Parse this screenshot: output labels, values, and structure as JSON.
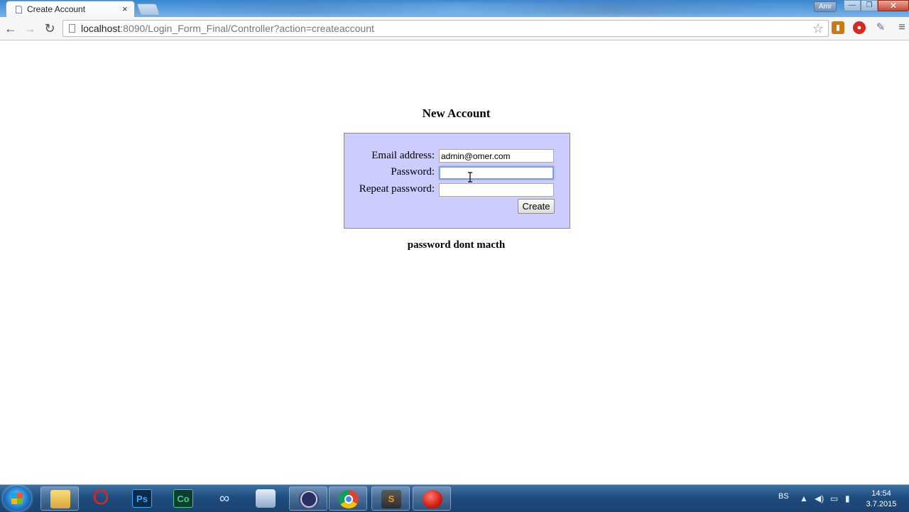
{
  "browser": {
    "tab": {
      "title": "Create Account",
      "close_glyph": "×"
    },
    "user_badge": "Amr",
    "window_controls": {
      "minimize": "—",
      "maximize": "❐",
      "close": "✕"
    },
    "toolbar": {
      "back_glyph": "←",
      "forward_glyph": "→",
      "reload_glyph": "↻",
      "url_host": "localhost",
      "url_rest": ":8090/Login_Form_Final/Controller?action=createaccount",
      "star_glyph": "☆",
      "menu_glyph": "≡",
      "extensions": [
        "bookmark-extension-icon",
        "adblock-icon",
        "eyedropper-icon"
      ]
    }
  },
  "page": {
    "title": "New Account",
    "form": {
      "email_label": "Email address:",
      "email_value": "admin@omer.com",
      "password_label": "Password:",
      "password_value": "",
      "repeat_label": "Repeat password:",
      "repeat_value": "",
      "submit_label": "Create"
    },
    "message": "password dont macth"
  },
  "taskbar": {
    "apps": [
      {
        "name": "windows-explorer",
        "label": ""
      },
      {
        "name": "opera",
        "label": "O"
      },
      {
        "name": "photoshop",
        "label": "Ps"
      },
      {
        "name": "dreamweaver-code",
        "label": "Co"
      },
      {
        "name": "visual-studio",
        "label": ""
      },
      {
        "name": "virtualbox",
        "label": ""
      },
      {
        "name": "eclipse",
        "label": ""
      },
      {
        "name": "chrome",
        "label": ""
      },
      {
        "name": "sublime-text",
        "label": "S"
      },
      {
        "name": "screen-recorder",
        "label": ""
      }
    ],
    "tray": {
      "language": "BS",
      "time": "14:54",
      "date": "3.7.2015"
    }
  }
}
